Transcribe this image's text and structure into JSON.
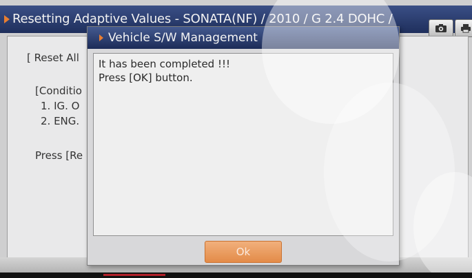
{
  "window": {
    "title": "Resetting Adaptive Values - SONATA(NF) / 2010 / G 2.4 DOHC /",
    "camera_icon": "camera-icon",
    "print_icon": "print-icon"
  },
  "background_panel": {
    "line1": "[ Reset All",
    "line2": "[Conditio",
    "line3": "1. IG. O",
    "line4": "2. ENG.",
    "line5": "Press [Re"
  },
  "dialog": {
    "title": "Vehicle S/W Management",
    "message_line1": "It has been completed !!!",
    "message_line2": "Press [OK] button.",
    "ok_label": "Ok"
  },
  "colors": {
    "title_bar": "#2a3d70",
    "accent_arrow": "#e87e31",
    "ok_button": "#e38b48"
  }
}
